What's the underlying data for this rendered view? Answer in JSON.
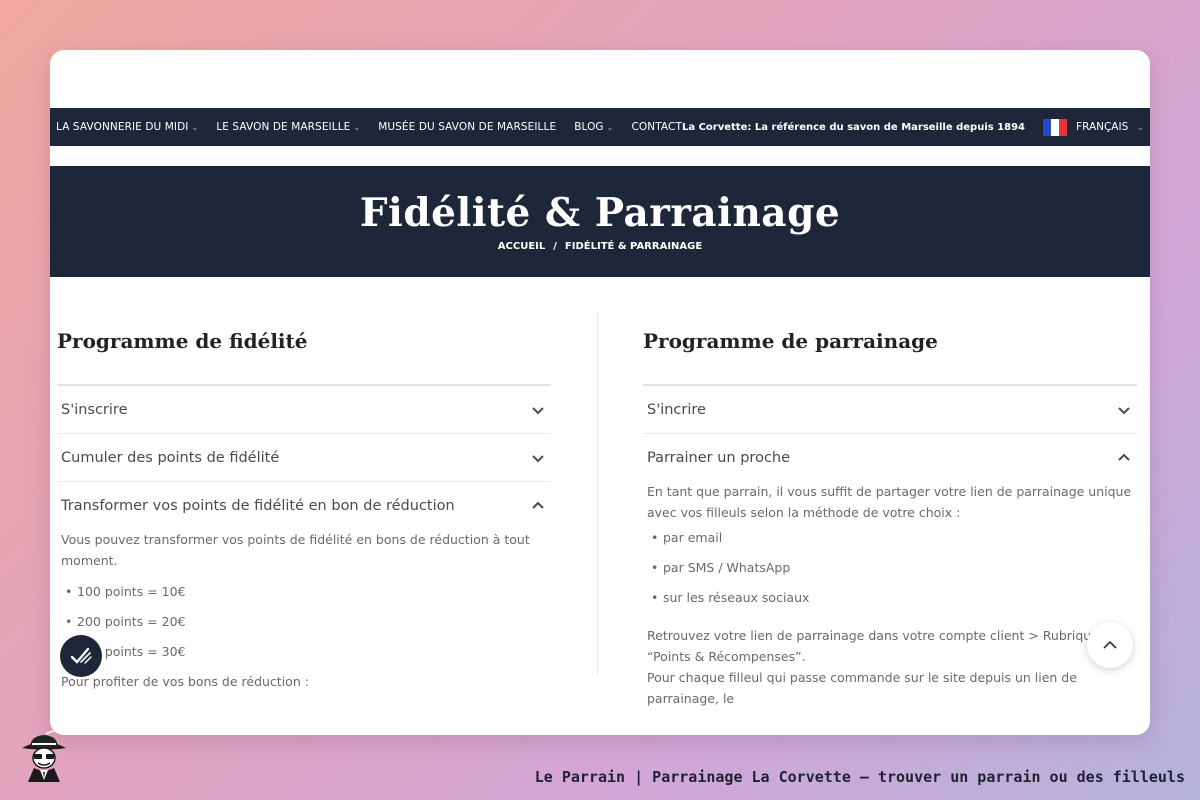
{
  "nav": {
    "items": [
      {
        "label": "LA SAVONNERIE DU MIDI",
        "has_dropdown": true
      },
      {
        "label": "LE SAVON DE MARSEILLE",
        "has_dropdown": true
      },
      {
        "label": "MUSÉE DU SAVON DE MARSEILLE",
        "has_dropdown": false
      },
      {
        "label": "BLOG",
        "has_dropdown": true
      },
      {
        "label": "CONTACT",
        "has_dropdown": false
      }
    ],
    "tagline": "La Corvette: La référence du savon de Marseille depuis 1894",
    "language": "FRANÇAIS"
  },
  "hero": {
    "title": "Fidélité & Parrainage",
    "breadcrumb": {
      "home": "ACCUEIL",
      "separator": "/",
      "current": "FIDÉLITÉ & PARRAINAGE"
    }
  },
  "loyalty": {
    "title": "Programme de fidélité",
    "items": [
      {
        "label": "S'inscrire"
      },
      {
        "label": "Cumuler des points de fidélité"
      },
      {
        "label": "Transformer vos points de fidélité en bon de réduction",
        "intro": "Vous pouvez transformer vos points de fidélité en bons de réduction à tout moment.",
        "list": [
          "100 points = 10€",
          "200 points = 20€",
          "300 points = 30€"
        ],
        "after": "Pour profiter de vos bons de réduction :"
      }
    ]
  },
  "referral": {
    "title": "Programme de parrainage",
    "items": [
      {
        "label": "S'incrire"
      },
      {
        "label": "Parrainer un proche",
        "intro": "En tant que parrain, il vous suffit de partager votre lien de parrainage unique avec vos filleuls selon la méthode de votre choix :",
        "list": [
          "par email",
          "par SMS / WhatsApp",
          "sur les réseaux sociaux"
        ],
        "after": "Retrouvez votre lien de parrainage dans votre compte client > Rubrique “Points & Récompenses”.",
        "after2": "Pour chaque filleul qui passe commande sur le site depuis un lien de parrainage, le"
      }
    ]
  },
  "footer": {
    "caption": "Le Parrain | Parrainage La Corvette — trouver un parrain ou des filleuls"
  },
  "colors": {
    "navy": "#1e2739",
    "text": "#4a4a4a",
    "muted": "#6a6a6a",
    "flag_blue": "#2847c9",
    "flag_red": "#e5323b"
  },
  "icons": {
    "scroll_top": "chevron-up-icon",
    "badge": "check-mark-icon",
    "accordion": "chevron-icon"
  }
}
